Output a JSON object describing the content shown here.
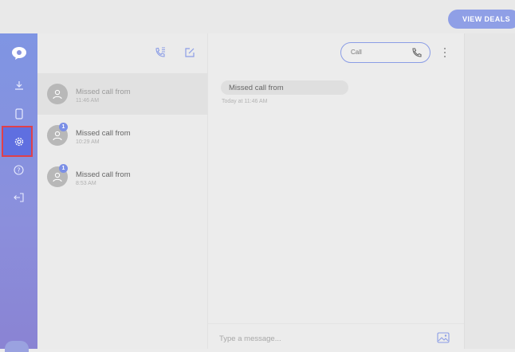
{
  "topbar": {
    "view_deals_label": "VIEW DEALS"
  },
  "colors": {
    "accent": "#8b9de6",
    "rail": "#8190e0",
    "selected_outline": "#e0404a",
    "badge": "#7b8fe6"
  },
  "rail": {
    "items": [
      {
        "icon": "viber-logo-icon"
      },
      {
        "icon": "download-icon"
      },
      {
        "icon": "phone-device-icon"
      },
      {
        "icon": "settings-gear-icon",
        "selected": true
      },
      {
        "icon": "help-icon"
      },
      {
        "icon": "logout-icon"
      }
    ]
  },
  "list_header": {
    "icons": [
      "call-contacts-icon",
      "compose-icon"
    ]
  },
  "conversations": [
    {
      "title": "Missed call from",
      "time": "11:46 AM",
      "badge": "",
      "active": true
    },
    {
      "title": "Missed call from",
      "time": "10:29 AM",
      "badge": "1",
      "active": false
    },
    {
      "title": "Missed call from",
      "time": "8:53 AM",
      "badge": "1",
      "active": false
    }
  ],
  "chat": {
    "call_label": "Call",
    "message_text": "Missed call from",
    "message_time": "Today at 11:46 AM",
    "composer_placeholder": "Type a message..."
  }
}
